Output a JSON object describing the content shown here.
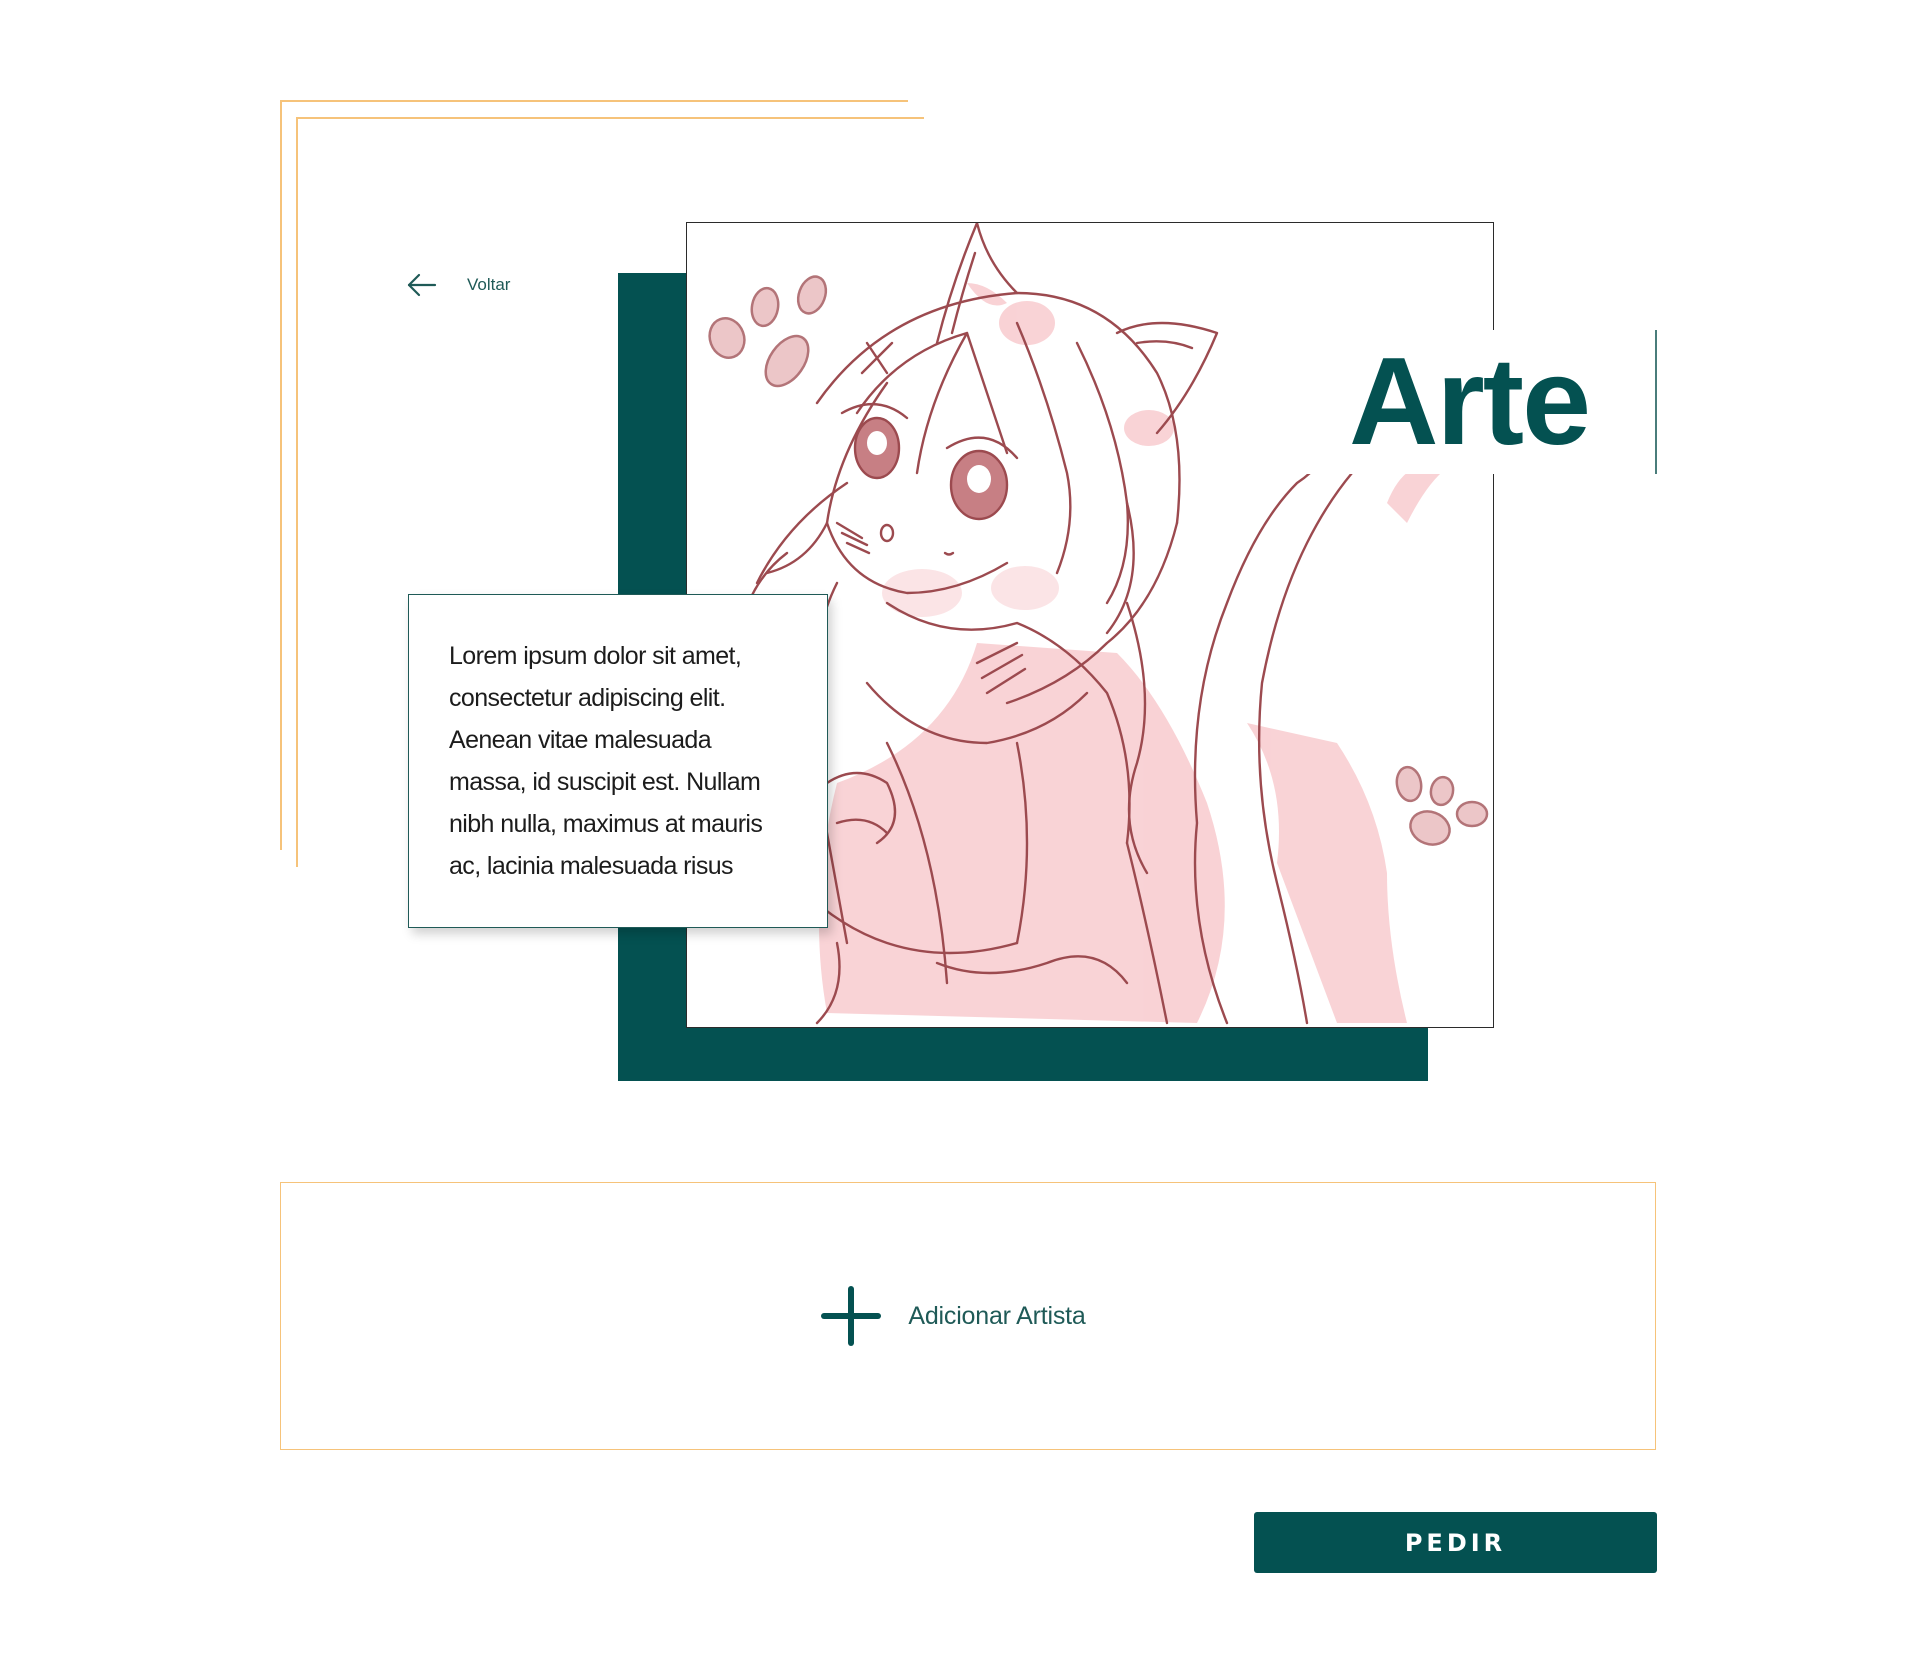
{
  "nav": {
    "back_label": "Voltar",
    "back_icon": "arrow-left-icon"
  },
  "artwork": {
    "title": "Arte",
    "description": "Lorem ipsum dolor sit amet, consectetur adipiscing elit. Aenean vitae malesuada massa, id suscipit est. Nullam nibh nulla, maximus at mauris ac, lacinia malesuada risus"
  },
  "artist_panel": {
    "add_label": "Adicionar Artista",
    "add_icon": "plus-icon"
  },
  "actions": {
    "order_label": "PEDIR"
  },
  "colors": {
    "primary": "#045151",
    "accent_line": "#f6c37a",
    "sketch_line": "#9c4a4f",
    "sketch_fill": "#f7c4c8"
  }
}
